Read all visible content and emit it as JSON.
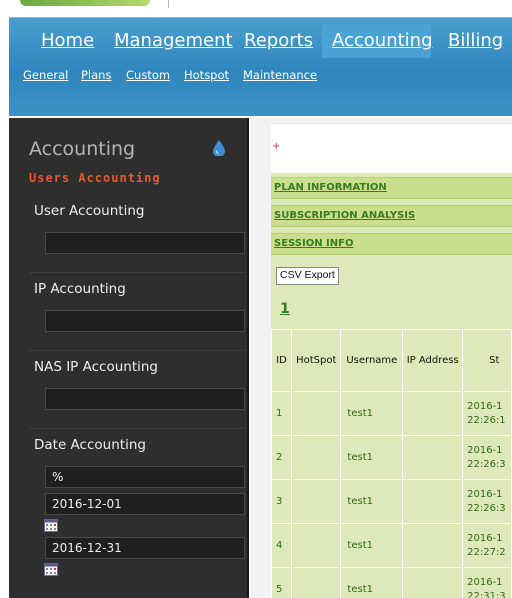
{
  "nav": {
    "menu": [
      {
        "label": "Home"
      },
      {
        "label": "Management"
      },
      {
        "label": "Reports"
      },
      {
        "label": "Accounting"
      },
      {
        "label": "Billing"
      }
    ],
    "submenu": [
      {
        "label": "General"
      },
      {
        "label": "Plans"
      },
      {
        "label": "Custom"
      },
      {
        "label": "Hotspot"
      },
      {
        "label": "Maintenance"
      }
    ]
  },
  "sidebar": {
    "title": "Accounting",
    "subtitle": "Users Accounting",
    "sections": {
      "user": "User Accounting",
      "ip": "IP Accounting",
      "nas": "NAS IP Accounting",
      "date": "Date Accounting"
    },
    "date_fields": {
      "pattern": "%",
      "start": "2016-12-01",
      "end": "2016-12-31"
    }
  },
  "content": {
    "mark": "+",
    "bars": [
      "PLAN INFORMATION",
      "SUBSCRIPTION ANALYSIS",
      "SESSION INFO"
    ],
    "csv_label": "CSV Export",
    "page_number": "1",
    "table": {
      "headers": {
        "id": "ID",
        "hotspot": "HotSpot",
        "username": "Username",
        "ip": "IP Address",
        "start": "St"
      },
      "rows": [
        {
          "id": "1",
          "username": "test1",
          "start_line1": "2016-1",
          "start_line2": "22:26:1"
        },
        {
          "id": "2",
          "username": "test1",
          "start_line1": "2016-1",
          "start_line2": "22:26:3"
        },
        {
          "id": "3",
          "username": "test1",
          "start_line1": "2016-1",
          "start_line2": "22:26:3"
        },
        {
          "id": "4",
          "username": "test1",
          "start_line1": "2016-1",
          "start_line2": "22:27:2"
        },
        {
          "id": "5",
          "username": "test1",
          "start_line1": "2016-1",
          "start_line2": "22:31:3"
        }
      ]
    }
  }
}
